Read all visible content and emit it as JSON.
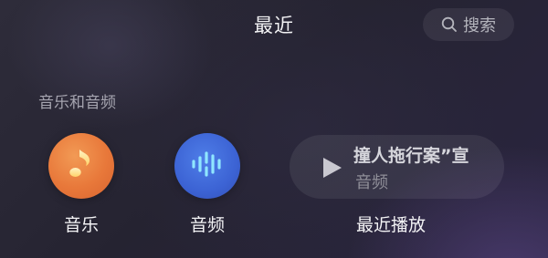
{
  "header": {
    "title": "最近",
    "search_label": "搜索",
    "search_icon": "search-icon"
  },
  "section": {
    "title": "音乐和音频"
  },
  "shortcuts": [
    {
      "label": "音乐",
      "icon": "music-note-icon",
      "color": "#E8783A"
    },
    {
      "label": "音频",
      "icon": "audio-waveform-icon",
      "color": "#3C63D4"
    }
  ],
  "recent": {
    "label": "最近播放",
    "title": "撞人拖行案”宣",
    "subtitle": "音频",
    "icon": "play-icon"
  }
}
